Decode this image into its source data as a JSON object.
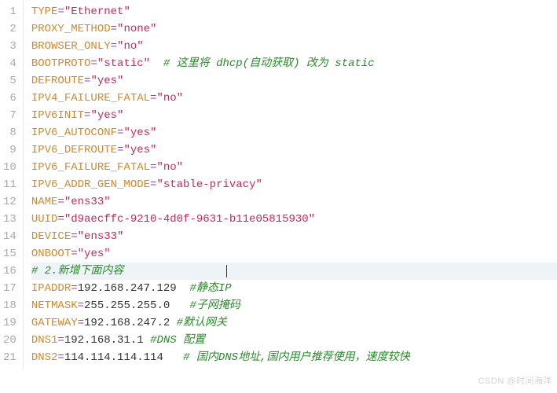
{
  "watermark": "CSDN @时间海洋",
  "lines": [
    {
      "n": 1,
      "hl": false,
      "tokens": [
        [
          "kw",
          "TYPE"
        ],
        [
          "op",
          "="
        ],
        [
          "str",
          "\"Ethernet\""
        ]
      ]
    },
    {
      "n": 2,
      "hl": false,
      "tokens": [
        [
          "kw",
          "PROXY_METHOD"
        ],
        [
          "op",
          "="
        ],
        [
          "str",
          "\"none\""
        ]
      ]
    },
    {
      "n": 3,
      "hl": false,
      "tokens": [
        [
          "kw",
          "BROWSER_ONLY"
        ],
        [
          "op",
          "="
        ],
        [
          "str",
          "\"no\""
        ]
      ]
    },
    {
      "n": 4,
      "hl": false,
      "tokens": [
        [
          "kw",
          "BOOTPROTO"
        ],
        [
          "op",
          "="
        ],
        [
          "str",
          "\"static\""
        ],
        [
          "plain",
          "  "
        ],
        [
          "cmt",
          "# 这里将 dhcp(自动获取) 改为 static"
        ]
      ]
    },
    {
      "n": 5,
      "hl": false,
      "tokens": [
        [
          "kw",
          "DEFROUTE"
        ],
        [
          "op",
          "="
        ],
        [
          "str",
          "\"yes\""
        ]
      ]
    },
    {
      "n": 6,
      "hl": false,
      "tokens": [
        [
          "kw",
          "IPV4_FAILURE_FATAL"
        ],
        [
          "op",
          "="
        ],
        [
          "str",
          "\"no\""
        ]
      ]
    },
    {
      "n": 7,
      "hl": false,
      "tokens": [
        [
          "kw",
          "IPV6INIT"
        ],
        [
          "op",
          "="
        ],
        [
          "str",
          "\"yes\""
        ]
      ]
    },
    {
      "n": 8,
      "hl": false,
      "tokens": [
        [
          "kw",
          "IPV6_AUTOCONF"
        ],
        [
          "op",
          "="
        ],
        [
          "str",
          "\"yes\""
        ]
      ]
    },
    {
      "n": 9,
      "hl": false,
      "tokens": [
        [
          "kw",
          "IPV6_DEFROUTE"
        ],
        [
          "op",
          "="
        ],
        [
          "str",
          "\"yes\""
        ]
      ]
    },
    {
      "n": 10,
      "hl": false,
      "tokens": [
        [
          "kw",
          "IPV6_FAILURE_FATAL"
        ],
        [
          "op",
          "="
        ],
        [
          "str",
          "\"no\""
        ]
      ]
    },
    {
      "n": 11,
      "hl": false,
      "tokens": [
        [
          "kw",
          "IPV6_ADDR_GEN_MODE"
        ],
        [
          "op",
          "="
        ],
        [
          "str",
          "\"stable-privacy\""
        ]
      ]
    },
    {
      "n": 12,
      "hl": false,
      "tokens": [
        [
          "kw",
          "NAME"
        ],
        [
          "op",
          "="
        ],
        [
          "str",
          "\"ens33\""
        ]
      ]
    },
    {
      "n": 13,
      "hl": false,
      "tokens": [
        [
          "kw",
          "UUID"
        ],
        [
          "op",
          "="
        ],
        [
          "str",
          "\"d9aecffc-9210-4d0f-9631-b11e05815930\""
        ]
      ]
    },
    {
      "n": 14,
      "hl": false,
      "tokens": [
        [
          "kw",
          "DEVICE"
        ],
        [
          "op",
          "="
        ],
        [
          "str",
          "\"ens33\""
        ]
      ]
    },
    {
      "n": 15,
      "hl": false,
      "tokens": [
        [
          "kw",
          "ONBOOT"
        ],
        [
          "op",
          "="
        ],
        [
          "str",
          "\"yes\""
        ]
      ]
    },
    {
      "n": 16,
      "hl": true,
      "tokens": [
        [
          "cmt",
          "# 2.新增下面内容"
        ]
      ]
    },
    {
      "n": 17,
      "hl": false,
      "tokens": [
        [
          "kw",
          "IPADDR"
        ],
        [
          "op",
          "="
        ],
        [
          "num",
          "192.168.247.129"
        ],
        [
          "plain",
          "  "
        ],
        [
          "cmt",
          "#静态IP"
        ]
      ]
    },
    {
      "n": 18,
      "hl": false,
      "tokens": [
        [
          "kw",
          "NETMASK"
        ],
        [
          "op",
          "="
        ],
        [
          "num",
          "255.255.255.0"
        ],
        [
          "plain",
          "   "
        ],
        [
          "cmt",
          "#子网掩码"
        ]
      ]
    },
    {
      "n": 19,
      "hl": false,
      "tokens": [
        [
          "kw",
          "GATEWAY"
        ],
        [
          "op",
          "="
        ],
        [
          "num",
          "192.168.247.2"
        ],
        [
          "plain",
          " "
        ],
        [
          "cmt",
          "#默认网关"
        ]
      ]
    },
    {
      "n": 20,
      "hl": false,
      "tokens": [
        [
          "kw",
          "DNS1"
        ],
        [
          "op",
          "="
        ],
        [
          "num",
          "192.168.31.1"
        ],
        [
          "plain",
          " "
        ],
        [
          "cmt",
          "#DNS 配置"
        ]
      ]
    },
    {
      "n": 21,
      "hl": false,
      "tokens": [
        [
          "kw",
          "DNS2"
        ],
        [
          "op",
          "="
        ],
        [
          "num",
          "114.114.114.114"
        ],
        [
          "plain",
          "   "
        ],
        [
          "cmt",
          "# 国内DNS地址,国内用户推荐使用，速度较快"
        ]
      ]
    }
  ]
}
